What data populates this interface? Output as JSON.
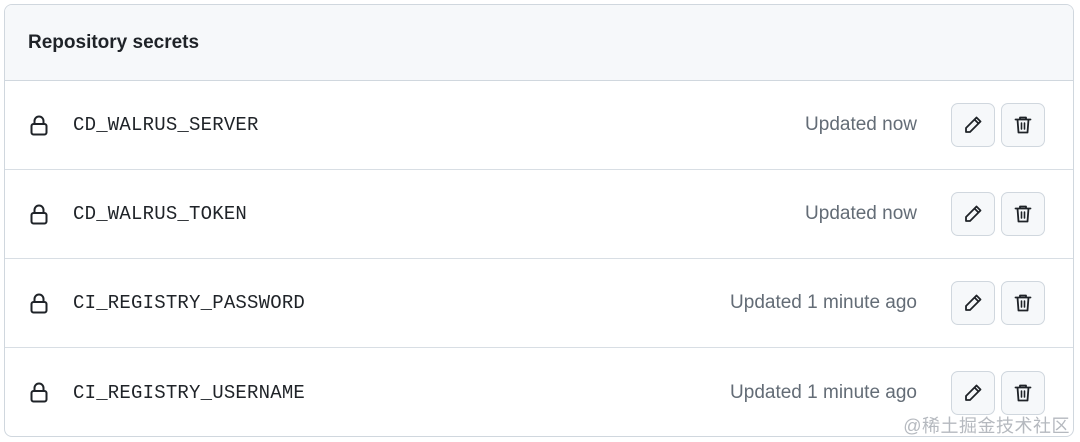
{
  "section": {
    "title": "Repository secrets"
  },
  "secrets": [
    {
      "name": "CD_WALRUS_SERVER",
      "updated": "Updated now"
    },
    {
      "name": "CD_WALRUS_TOKEN",
      "updated": "Updated now"
    },
    {
      "name": "CI_REGISTRY_PASSWORD",
      "updated": "Updated 1 minute ago"
    },
    {
      "name": "CI_REGISTRY_USERNAME",
      "updated": "Updated 1 minute ago"
    }
  ],
  "icons": {
    "lock": "lock-icon",
    "edit": "pencil-icon",
    "delete": "trash-icon"
  },
  "colors": {
    "border": "#d0d7de",
    "header_bg": "#f6f8fa",
    "text": "#1f2328",
    "muted_text": "#636c76"
  },
  "watermark": "@稀土掘金技术社区"
}
